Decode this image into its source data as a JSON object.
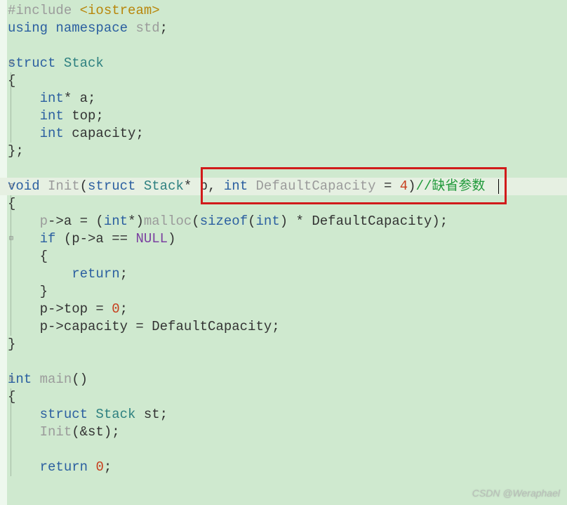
{
  "code": {
    "l1": {
      "pre": "#include ",
      "inc": "<iostream>"
    },
    "l2": {
      "kw1": "using",
      "kw2": "namespace",
      "id": "std",
      "p": ";"
    },
    "l3": "",
    "l4": {
      "kw": "struct",
      "ty": "Stack"
    },
    "l5": "{",
    "l6": {
      "ind": "    ",
      "ty": "int",
      "rest": "* a;"
    },
    "l7": {
      "ind": "    ",
      "ty": "int",
      "rest": " top;"
    },
    "l8": {
      "ind": "    ",
      "ty": "int",
      "rest": " capacity;"
    },
    "l9": "};",
    "l10": "",
    "l11": {
      "ret": "void",
      "fn": "Init",
      "op": "(",
      "kw1": "struct",
      "ty1": "Stack",
      "p1": "* p, ",
      "ty2": "int",
      "arg": " DefaultCapacity ",
      "eq": "= ",
      "num": "4",
      "cp": ")",
      "cmt": "//缺省参数"
    },
    "l12": "{",
    "l13": {
      "ind": "    ",
      "a": "p",
      "b": "->a = (",
      "ty1": "int",
      "c": "*)",
      "fn": "malloc",
      "d": "(",
      "kw": "sizeof",
      "e": "(",
      "ty2": "int",
      "f": ") * DefaultCapacity);"
    },
    "l14": {
      "ind": "    ",
      "kw": "if",
      "a": " (p->a == ",
      "null": "NULL",
      "b": ")"
    },
    "l15": {
      "ind": "    ",
      "br": "{"
    },
    "l16": {
      "ind": "        ",
      "kw": "return",
      "p": ";"
    },
    "l17": {
      "ind": "    ",
      "br": "}"
    },
    "l18": {
      "ind": "    ",
      "a": "p->top = ",
      "num": "0",
      "b": ";"
    },
    "l19": {
      "ind": "    ",
      "a": "p->capacity = DefaultCapacity;"
    },
    "l20": "}",
    "l21": "",
    "l22": {
      "ty": "int",
      "fn": " main",
      "rest": "()"
    },
    "l23": "{",
    "l24": {
      "ind": "    ",
      "kw": "struct",
      "ty": " Stack",
      "rest": " st;"
    },
    "l25": {
      "ind": "    ",
      "fn": "Init",
      "rest": "(&st);"
    },
    "l26": "",
    "l27": {
      "ind": "    ",
      "kw": "return",
      "sp": " ",
      "num": "0",
      "p": ";"
    }
  },
  "folds": {
    "f1": "⊟",
    "f2": "⊟",
    "f3": "⊟",
    "f4": "⊟"
  },
  "watermark": "CSDN @Weraphael"
}
